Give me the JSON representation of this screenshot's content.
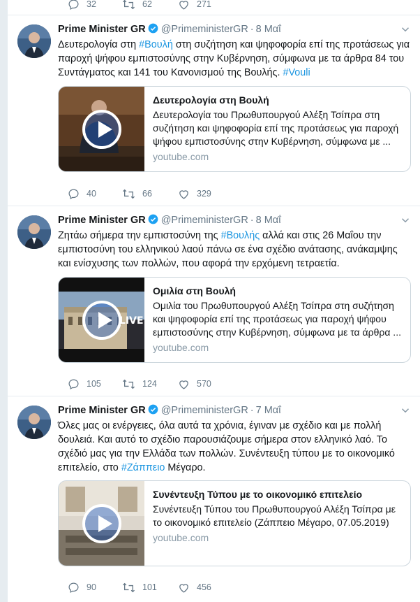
{
  "top_actions": {
    "replies": "32",
    "retweets": "62",
    "likes": "271"
  },
  "tweets": [
    {
      "name": "Prime Minister GR",
      "handle": "@PrimeministerGR",
      "time": "8 Μαΐ",
      "text_parts": [
        "Δευτερολογία στη ",
        "#Βουλή",
        " στη συζήτηση και ψηφοφορία επί της προτάσεως για παροχή ψήφου εμπιστοσύνης στην Κυβέρνηση, σύμφωνα με τα άρθρα 84 του Συντάγματος και 141 του Κανονισμού της Βουλής. ",
        "#Vouli"
      ],
      "card": {
        "title": "Δευτερολογία στη Βουλή",
        "description": "Δευτερολογία του Πρωθυπουργού Αλέξη Τσίπρα στη συζήτηση και ψηφοφορία επί της προτάσεως για παροχή ψήφου εμπιστοσύνης στην Κυβέρνηση, σύμφωνα με ...",
        "domain": "youtube.com"
      },
      "replies": "40",
      "retweets": "66",
      "likes": "329"
    },
    {
      "name": "Prime Minister GR",
      "handle": "@PrimeministerGR",
      "time": "8 Μαΐ",
      "text_parts": [
        "Ζητάω σήμερα την εμπιστοσύνη της ",
        "#Βουλής",
        " αλλά και στις 26 Μαΐου την εμπιστοσύνη του ελληνικού λαού πάνω σε ένα σχέδιο ανάτασης, ανάκαμψης και ενίσχυσης των πολλών, που αφορά την ερχόμενη τετραετία.",
        ""
      ],
      "card": {
        "title": "Ομιλία στη Βουλή",
        "description": "Ομιλία του Πρωθυπουργού Αλέξη Τσίπρα στη συζήτηση και ψηφοφορία επί της προτάσεως για παροχή ψήφου εμπιστοσύνης στην Κυβέρνηση, σύμφωνα με τα άρθρα ...",
        "domain": "youtube.com",
        "thumb_label": "LIVE"
      },
      "replies": "105",
      "retweets": "124",
      "likes": "570"
    },
    {
      "name": "Prime Minister GR",
      "handle": "@PrimeministerGR",
      "time": "7 Μαΐ",
      "text_parts": [
        "Όλες μας οι ενέργειες, όλα αυτά τα χρόνια, έγιναν με σχέδιο και με πολλή δουλειά. Και αυτό το σχέδιο παρουσιάζουμε σήμερα στον ελληνικό λαό. Το σχέδιό μας για την Ελλάδα των πολλών. Συνέντευξη τύπου με το οικονομικό επιτελείο, στο ",
        "#Ζάππειο",
        " Μέγαρο.",
        ""
      ],
      "card": {
        "title": "Συνέντευξη Τύπου με το οικονομικό επιτελείο",
        "description": "Συνέντευξη Τύπου του Πρωθυπουργού Αλέξη Τσίπρα με το οικονομικό επιτελείο (Ζάππειο Μέγαρο, 07.05.2019)",
        "domain": "youtube.com"
      },
      "replies": "90",
      "retweets": "101",
      "likes": "456"
    }
  ],
  "colors": {
    "link": "#1b95e0",
    "verified": "#1da1f2",
    "meta": "#657786",
    "border": "#e6ecf0"
  },
  "icons": [
    "reply-icon",
    "retweet-icon",
    "like-icon",
    "verified-icon",
    "caret-down-icon",
    "play-icon"
  ]
}
